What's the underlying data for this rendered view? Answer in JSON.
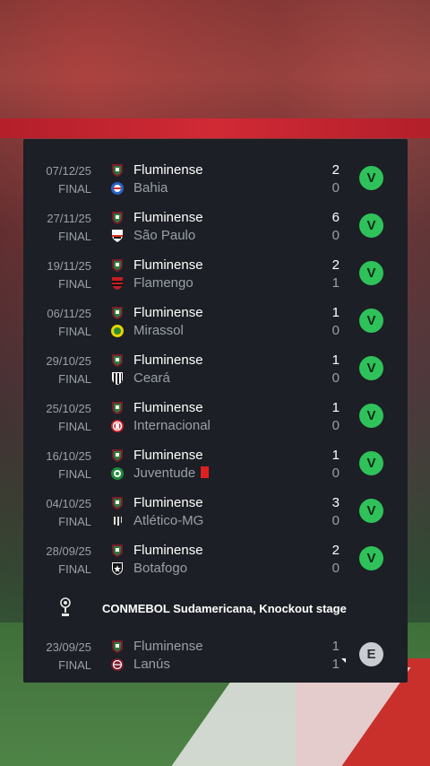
{
  "matches": [
    {
      "date": "07/12/25",
      "status": "FINAL",
      "home": "Fluminense",
      "away": "Bahia",
      "home_score": "2",
      "away_score": "0",
      "result": "V"
    },
    {
      "date": "27/11/25",
      "status": "FINAL",
      "home": "Fluminense",
      "away": "São Paulo",
      "home_score": "6",
      "away_score": "0",
      "result": "V"
    },
    {
      "date": "19/11/25",
      "status": "FINAL",
      "home": "Fluminense",
      "away": "Flamengo",
      "home_score": "2",
      "away_score": "1",
      "result": "V"
    },
    {
      "date": "06/11/25",
      "status": "FINAL",
      "home": "Fluminense",
      "away": "Mirassol",
      "home_score": "1",
      "away_score": "0",
      "result": "V"
    },
    {
      "date": "29/10/25",
      "status": "FINAL",
      "home": "Fluminense",
      "away": "Ceará",
      "home_score": "1",
      "away_score": "0",
      "result": "V"
    },
    {
      "date": "25/10/25",
      "status": "FINAL",
      "home": "Fluminense",
      "away": "Internacional",
      "home_score": "1",
      "away_score": "0",
      "result": "V"
    },
    {
      "date": "16/10/25",
      "status": "FINAL",
      "home": "Fluminense",
      "away": "Juventude",
      "home_score": "1",
      "away_score": "0",
      "result": "V"
    },
    {
      "date": "04/10/25",
      "status": "FINAL",
      "home": "Fluminense",
      "away": "Atlético-MG",
      "home_score": "3",
      "away_score": "0",
      "result": "V"
    },
    {
      "date": "28/09/25",
      "status": "FINAL",
      "home": "Fluminense",
      "away": "Botafogo",
      "home_score": "2",
      "away_score": "0",
      "result": "V"
    }
  ],
  "section": {
    "label": "CONMEBOL Sudamericana, Knockout stage",
    "icon": "trophy-icon"
  },
  "cup_match": {
    "date": "23/09/25",
    "status": "FINAL",
    "home": "Fluminense",
    "away": "Lanús",
    "home_score": "1",
    "away_score": "1",
    "result": "E"
  },
  "colors": {
    "win": "#2fc25a",
    "draw": "#c9ccd1",
    "panel": "#1c1f25",
    "red_card": "#e02020"
  }
}
